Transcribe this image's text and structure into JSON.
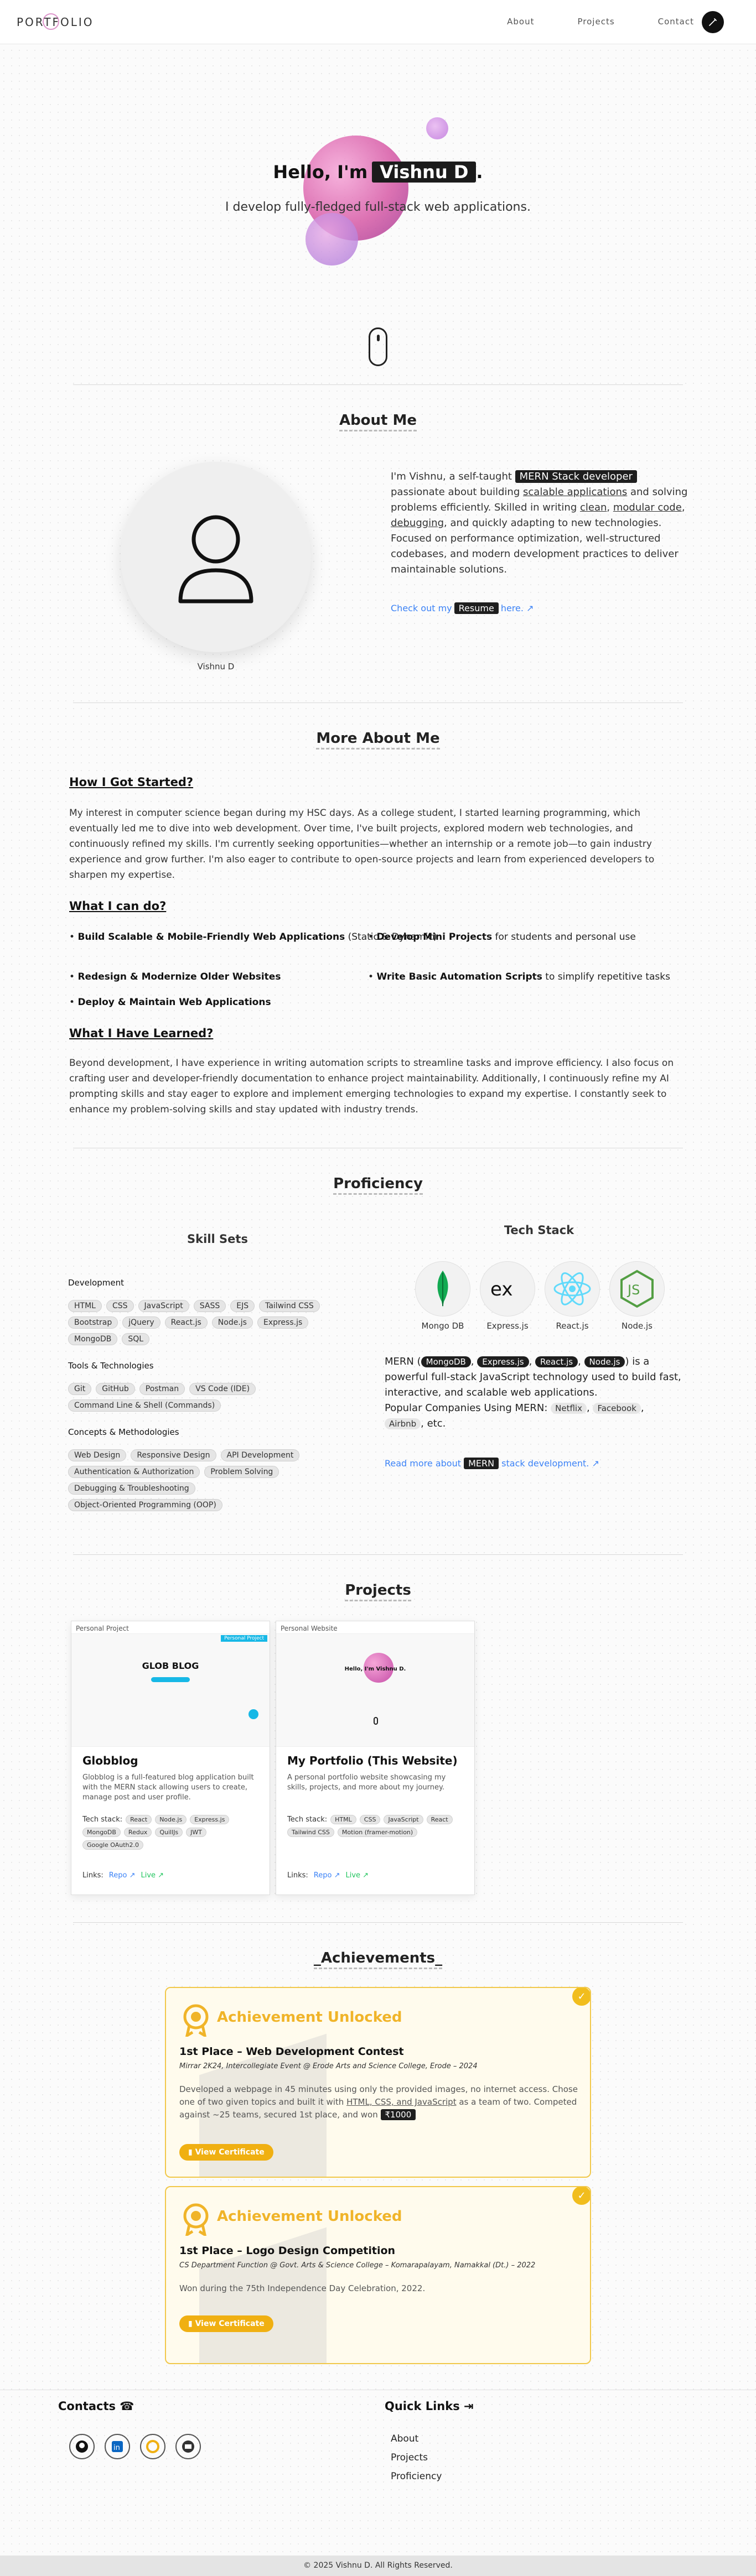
{
  "nav": {
    "logo": "PORTFOLIO",
    "links": [
      "About",
      "Projects",
      "Contact"
    ],
    "theme_icon": "moon-icon"
  },
  "hero": {
    "greeting": "Hello, I'm",
    "name": "Vishnu D",
    "period": ".",
    "tagline": "I develop fully-fledged full-stack web applications."
  },
  "about": {
    "title": "About Me",
    "avatar_name": "Vishnu D",
    "p1": "I'm Vishnu, a self-taught",
    "chip": "MERN Stack developer",
    "p2": "passionate about building",
    "u1": "scalable applications",
    "p3": "and solving problems efficiently. Skilled in writing",
    "u2": "clean",
    "u3": "modular code",
    "u4": "debugging",
    "p4": ", and quickly adapting to new technologies. Focused on performance optimization, well-structured codebases, and modern development practices to deliver maintainable solutions.",
    "link_pre": "Check out my",
    "link_chip": "Resume",
    "link_post": "here. ↗"
  },
  "more": {
    "title": "More About Me",
    "h1": "How I Got Started?",
    "start_text": "My interest in computer science began during my HSC days. As a college student, I started learning programming, which eventually led me to dive into web development. Over time, I've built projects, explored modern web technologies, and continuously refined my skills. I'm currently seeking opportunities—whether an internship or a remote job—to gain industry experience and grow further. I'm also eager to contribute to open-source projects and learn from experienced developers to sharpen my expertise.",
    "h2": "What I can do?",
    "can": [
      {
        "b": "Build Scalable & Mobile-Friendly Web Applications",
        "t": " (Static & Dynamic)"
      },
      {
        "b": "Develop Mini Projects",
        "t": " for students and personal use"
      },
      {
        "b": "Redesign & Modernize Older Websites",
        "t": ""
      },
      {
        "b": "Write Basic Automation Scripts",
        "t": " to simplify repetitive tasks"
      },
      {
        "b": "Deploy & Maintain Web Applications",
        "t": ""
      }
    ],
    "h3": "What I Have Learned?",
    "learned_text": "Beyond development, I have experience in writing automation scripts to streamline tasks and improve efficiency. I also focus on crafting user and developer-friendly documentation to enhance project maintainability. Additionally, I continuously refine my AI prompting skills and stay eager to explore and implement emerging technologies to expand my expertise. I constantly seek to enhance my problem-solving skills and stay updated with industry trends."
  },
  "proficiency": {
    "title": "Proficiency",
    "skills_title": "Skill Sets",
    "groups": [
      {
        "name": "Development",
        "items": [
          "HTML",
          "CSS",
          "JavaScript",
          "SASS",
          "EJS",
          "Tailwind CSS",
          "Bootstrap",
          "jQuery",
          "React.js",
          "Node.js",
          "Express.js",
          "MongoDB",
          "SQL"
        ]
      },
      {
        "name": "Tools & Technologies",
        "items": [
          "Git",
          "GitHub",
          "Postman",
          "VS Code (IDE)",
          "Command Line & Shell (Commands)"
        ]
      },
      {
        "name": "Concepts & Methodologies",
        "items": [
          "Web Design",
          "Responsive Design",
          "API Development",
          "Authentication & Authorization",
          "Problem Solving",
          "Debugging & Troubleshooting",
          "Object-Oriented Programming (OOP)"
        ]
      }
    ],
    "tech_title": "Tech Stack",
    "tech": [
      "Mongo DB",
      "Express.js",
      "React.js",
      "Node.js"
    ],
    "mern_pre": "MERN (",
    "mern_chips": [
      "MongoDB",
      "Express.js",
      "React.js",
      "Node.js"
    ],
    "mern_post": ") is a powerful full-stack JavaScript technology used to build fast, interactive, and scalable web applications.",
    "popular": "Popular Companies Using MERN:",
    "companies": [
      "Netflix",
      "Facebook",
      "Airbnb"
    ],
    "etc": ", etc.",
    "read_pre": "Read more about",
    "read_chip": "MERN",
    "read_post": "stack development. ↗"
  },
  "projects": {
    "title": "Projects",
    "cards": [
      {
        "tag": "Personal Project",
        "name": "Globblog",
        "desc": "Globblog is a full-featured blog application built with the MERN stack allowing users to create, manage post and user profile.",
        "tech_label": "Tech stack:",
        "tech": [
          "React",
          "Node.js",
          "Express.js",
          "MongoDB",
          "Redux",
          "QuillJs",
          "JWT",
          "Google OAuth2.0"
        ],
        "links_label": "Links:",
        "repo": "Repo ↗",
        "live": "Live ↗",
        "shot_title": "GLOB BLOG",
        "shot_badge": "Personal Project"
      },
      {
        "tag": "Personal Website",
        "name": "My Portfolio (This Website)",
        "desc": "A personal portfolio website showcasing my skills, projects, and more about my journey.",
        "tech_label": "Tech stack:",
        "tech": [
          "HTML",
          "CSS",
          "JavaScript",
          "React",
          "Tailwind CSS",
          "Motion (framer-motion)"
        ],
        "links_label": "Links:",
        "repo": "Repo ↗",
        "live": "Live ↗",
        "shot_title": "Hello, I'm Vishnu D."
      }
    ]
  },
  "achievements": {
    "title": "_Achievements_",
    "items": [
      {
        "unlock": "Achievement Unlocked",
        "title": "1st Place – Web Development Contest",
        "sub": "Mirrar 2K24, Intercollegiate Event @ Erode Arts and Science College, Erode – 2024",
        "desc_a": "Developed a webpage in 45 minutes using only the provided images, no internet access. Chose one of two given topics and built it with ",
        "desc_u": "HTML, CSS, and JavaScript",
        "desc_b": " as a team of two. Competed against ~25 teams, secured 1st place, and won",
        "prize": "₹1000",
        "btn": "View Certificate"
      },
      {
        "unlock": "Achievement Unlocked",
        "title": "1st Place – Logo Design Competition",
        "sub": "CS Department Function @ Govt. Arts & Science College – Komarapalayam, Namakkal (Dt.) – 2022",
        "desc_a": "Won during the 75th Independence Day Celebration, 2022.",
        "btn": "View Certificate"
      }
    ]
  },
  "footer": {
    "contacts": "Contacts",
    "contact_icons": [
      "github-icon",
      "linkedin-icon",
      "hashnode-icon",
      "mail-icon"
    ],
    "quick": "Quick Links",
    "links": [
      "About",
      "Projects",
      "Proficiency"
    ],
    "copyright": "© 2025 Vishnu D. All Rights Reserved."
  }
}
